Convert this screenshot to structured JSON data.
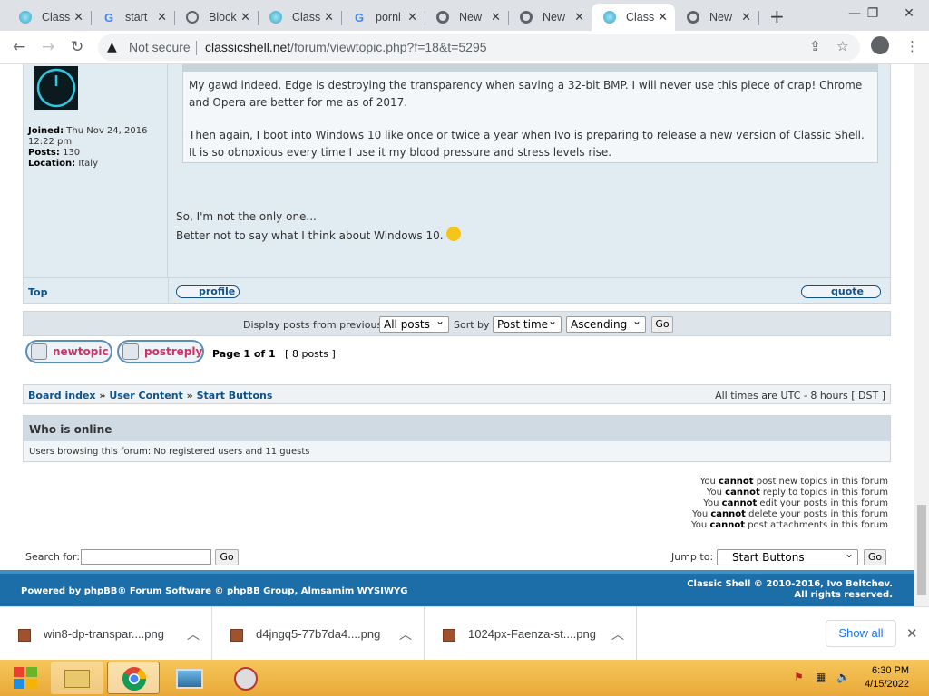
{
  "browser": {
    "tabs": [
      {
        "title": "Class",
        "icon": "classic-shell-favicon"
      },
      {
        "title": "start",
        "icon": "google-icon"
      },
      {
        "title": "Block",
        "icon": "globe-icon"
      },
      {
        "title": "Class",
        "icon": "classic-shell-favicon"
      },
      {
        "title": "pornl",
        "icon": "google-icon"
      },
      {
        "title": "New",
        "icon": "chrome-icon"
      },
      {
        "title": "New",
        "icon": "chrome-icon"
      },
      {
        "title": "Class",
        "icon": "classic-shell-favicon",
        "active": true
      },
      {
        "title": "New",
        "icon": "chrome-icon"
      }
    ],
    "omnibox": {
      "security_label": "Not secure",
      "url_host": "classicshell.net",
      "url_path": "/forum/viewtopic.php?f=18&t=5295"
    }
  },
  "post": {
    "profile": {
      "joined_label": "Joined:",
      "joined_value": "Thu Nov 24, 2016 12:22 pm",
      "posts_label": "Posts:",
      "posts_value": "130",
      "location_label": "Location:",
      "location_value": "Italy"
    },
    "quote_p1": "My gawd indeed. Edge is destroying the transparency when saving a 32-bit BMP. I will never use this piece of crap! Chrome and Opera are better for me as of 2017.",
    "quote_p2": "Then again, I boot into Windows 10 like once or twice a year when Ivo is preparing to release a new version of Classic Shell. It is so obnoxious every time I use it my blood pressure and stress levels rise.",
    "reply_line1": "So, I'm not the only one...",
    "reply_line2": "Better not to say what I think about Windows 10.",
    "top_link": "Top",
    "profile_button": "profile",
    "quote_button": "quote"
  },
  "display": {
    "label": "Display posts from previous:",
    "posts_select": "All posts",
    "sort_label": "Sort by",
    "sort_select": "Post time",
    "order_select": "Ascending",
    "go": "Go"
  },
  "pagination": {
    "newtopic": "newtopic",
    "postreply": "postreply",
    "page_text": "Page 1 of 1",
    "posts_count": "[ 8 posts ]"
  },
  "breadcrumb": {
    "items": [
      "Board index",
      "User Content",
      "Start Buttons"
    ],
    "sep": "»",
    "timezone": "All times are UTC - 8 hours [ DST ]"
  },
  "who_online": {
    "title": "Who is online",
    "text": "Users browsing this forum: No registered users and 11 guests"
  },
  "permissions": [
    {
      "pre": "You ",
      "bold": "cannot",
      "post": " post new topics in this forum"
    },
    {
      "pre": "You ",
      "bold": "cannot",
      "post": " reply to topics in this forum"
    },
    {
      "pre": "You ",
      "bold": "cannot",
      "post": " edit your posts in this forum"
    },
    {
      "pre": "You ",
      "bold": "cannot",
      "post": " delete your posts in this forum"
    },
    {
      "pre": "You ",
      "bold": "cannot",
      "post": " post attachments in this forum"
    }
  ],
  "search": {
    "label": "Search for:",
    "go": "Go"
  },
  "jump": {
    "label": "Jump to:",
    "value": "Start Buttons",
    "go": "Go"
  },
  "footer": {
    "left": "Powered by phpBB® Forum Software © phpBB Group, Almsamim WYSIWYG",
    "right1": "Classic Shell © 2010-2016, Ivo Beltchev.",
    "right2": "All rights reserved."
  },
  "downloads": {
    "files": [
      "win8-dp-transpar....png",
      "d4jngq5-77b7da4....png",
      "1024px-Faenza-st....png"
    ],
    "show_all": "Show all"
  },
  "taskbar": {
    "time": "6:30 PM",
    "date": "4/15/2022"
  }
}
